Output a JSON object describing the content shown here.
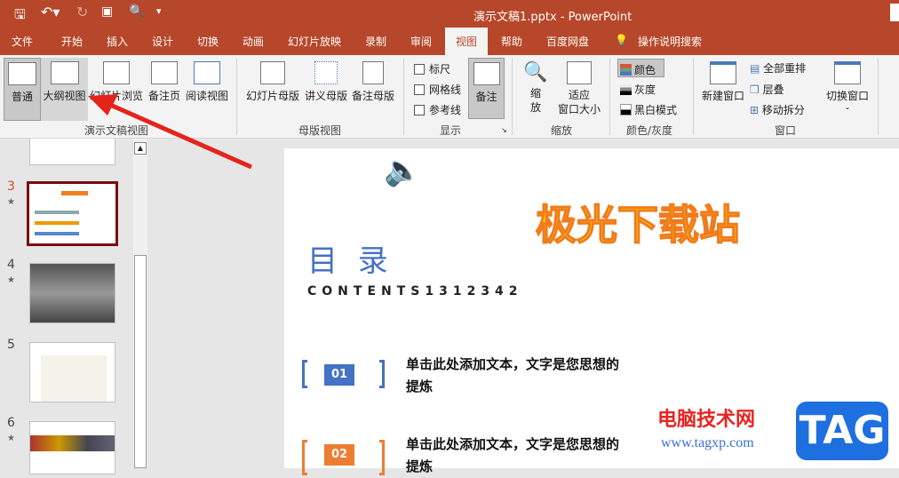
{
  "titlebar": {
    "title": "演示文稿1.pptx  -  PowerPoint"
  },
  "tabs": [
    "文件",
    "开始",
    "插入",
    "设计",
    "切换",
    "动画",
    "幻灯片放映",
    "录制",
    "审阅",
    "视图",
    "帮助",
    "百度网盘"
  ],
  "active_tab": "视图",
  "search": "操作说明搜索",
  "ribbon": {
    "presentation_views": {
      "label": "演示文稿视图",
      "buttons": [
        "普通",
        "大纲视图",
        "幻灯片浏览",
        "备注页",
        "阅读视图"
      ]
    },
    "master_views": {
      "label": "母版视图",
      "buttons": [
        "幻灯片母版",
        "讲义母版",
        "备注母版"
      ]
    },
    "show": {
      "label": "显示",
      "checks": [
        "标尺",
        "网格线",
        "参考线"
      ],
      "notes": "备注"
    },
    "zoom": {
      "label": "缩放",
      "zoom": "缩\n放",
      "fit": "适应\n窗口大小"
    },
    "color": {
      "label": "颜色/灰度",
      "items": [
        "颜色",
        "灰度",
        "黑白模式"
      ]
    },
    "window": {
      "label": "窗口",
      "new": "新建窗口",
      "arrange": "全部重排",
      "cascade": "层叠",
      "split": "移动拆分",
      "switch": "切换窗口"
    }
  },
  "thumbs": {
    "numbers": [
      "3",
      "4",
      "5",
      "6"
    ],
    "star": "★"
  },
  "slide": {
    "banner": "极光下载站",
    "heading": "目 录",
    "subheading": "CONTENTS1312342",
    "items": [
      {
        "num": "01",
        "text": "单击此处添加文本，文字是您思想的提炼",
        "color": "#4472c4"
      },
      {
        "num": "02",
        "text": "单击此处添加文本，文字是您思想的提炼",
        "color": "#ed7d31"
      }
    ]
  },
  "watermark": {
    "site": "电脑技术网",
    "url": "www.tagxp.com",
    "logo": "TAG"
  }
}
